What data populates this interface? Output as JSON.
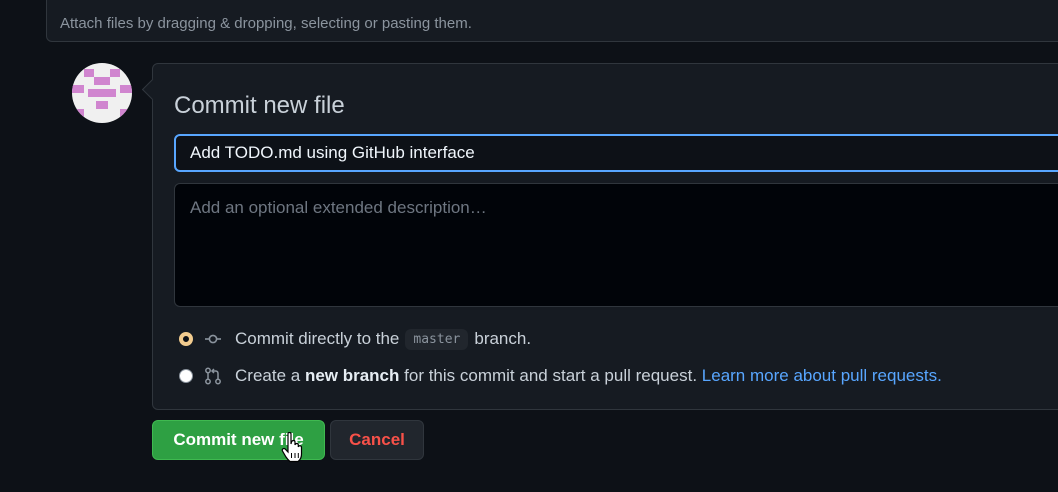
{
  "attach": {
    "hint": "Attach files by dragging & dropping, selecting or pasting them."
  },
  "commit": {
    "title": "Commit new file",
    "summary_value": "Add TODO.md using GitHub interface",
    "description_placeholder": "Add an optional extended description…",
    "options": {
      "direct": {
        "text_before": "Commit directly to the",
        "branch": "master",
        "text_after": "branch.",
        "selected": true
      },
      "new_branch": {
        "text_before": "Create a",
        "bold": "new branch",
        "text_after": "for this commit and start a pull request.",
        "link": "Learn more about pull requests.",
        "selected": false
      }
    }
  },
  "buttons": {
    "commit_label": "Commit new file",
    "cancel_label": "Cancel"
  },
  "colors": {
    "accent": "#58a6ff",
    "primary_button": "#2ea043",
    "danger": "#f85149",
    "background": "#0d1117"
  },
  "icons": {
    "direct": "git-commit-icon",
    "new_branch": "git-pull-request-icon"
  }
}
